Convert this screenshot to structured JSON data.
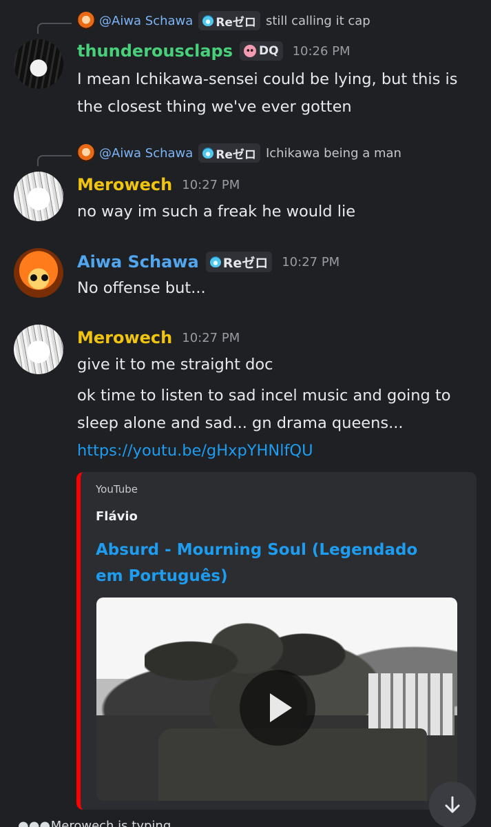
{
  "messages": [
    {
      "reply": {
        "mention": "@Aiwa Schawa",
        "tag": "Reゼロ",
        "text": "still calling it cap"
      },
      "username": "thunderousclaps",
      "tag": "DQ",
      "time": "10:26 PM",
      "lines": [
        "I mean Ichikawa-sensei could be lying, but this is",
        "the closest thing we've ever gotten"
      ]
    },
    {
      "reply": {
        "mention": "@Aiwa Schawa",
        "tag": "Reゼロ",
        "text": "Ichikawa being a man"
      },
      "username": "Merowech",
      "time": "10:27 PM",
      "lines": [
        "no way im such a freak he would lie"
      ]
    },
    {
      "username": "Aiwa Schawa",
      "tag": "Reゼロ",
      "time": "10:27 PM",
      "lines": [
        "No offense but..."
      ]
    },
    {
      "username": "Merowech",
      "time": "10:27 PM",
      "lines": [
        "give it to me straight doc"
      ],
      "followups": [
        "ok time to listen to sad incel music and going to",
        "sleep alone and sad... gn drama queens..."
      ],
      "link": "https://youtu.be/gHxpYHNlfQU"
    }
  ],
  "embed": {
    "provider": "YouTube",
    "author": "Flávio",
    "title": "Absurd  - Mourning Soul (Legendado em Português)",
    "accent": "#ff0000"
  },
  "colors": {
    "background": "#1f2024",
    "green_user": "#48d17a",
    "yellow_user": "#f1c40f",
    "blue_user": "#51a6f0",
    "link": "#1e9cf0"
  },
  "footer": {
    "typing_text": "Merowech is typing..."
  }
}
